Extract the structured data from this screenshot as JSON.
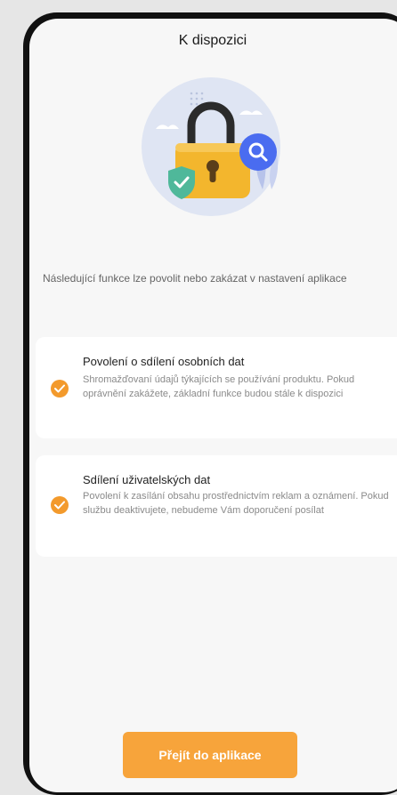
{
  "header": {
    "title": "K dispozici"
  },
  "intro": {
    "text": "Následující funkce lze povolit nebo zakázat v nastavení aplikace"
  },
  "permissions": [
    {
      "title": "Povolení o sdílení osobních dat",
      "description": "Shromažďovaní údajů týkajících se používání produktu. Pokud oprávnění zakážete, základní funkce budou stále k dispozici",
      "checked": true
    },
    {
      "title": "Sdílení uživatelských dat",
      "description": "Povolení k zasílání obsahu prostřednictvím reklam a oznámení. Pokud službu deaktivujete, nebudeme Vám doporučení posílat",
      "checked": true
    }
  ],
  "cta": {
    "label": "Přejít do aplikace"
  },
  "colors": {
    "accent": "#f39a2c",
    "button": "#f7a43b",
    "shield": "#4fb89a",
    "search_badge": "#4a6cf0"
  },
  "icons": [
    "padlock-illustration",
    "shield-check-icon",
    "search-icon",
    "check-icon"
  ]
}
